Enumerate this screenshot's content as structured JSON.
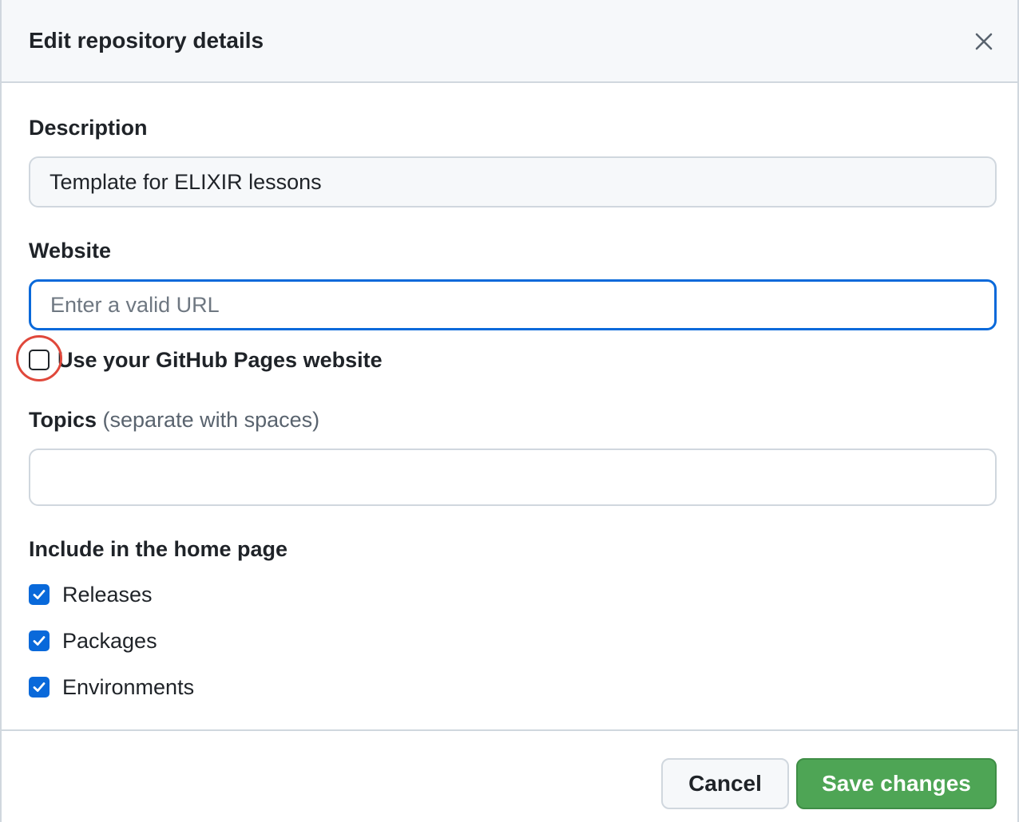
{
  "dialog": {
    "title": "Edit repository details",
    "close_icon": "close-icon"
  },
  "description": {
    "label": "Description",
    "value": "Template for ELIXIR lessons"
  },
  "website": {
    "label": "Website",
    "value": "",
    "placeholder": "Enter a valid URL",
    "pages_checkbox": {
      "label": "Use your GitHub Pages website",
      "checked": false
    }
  },
  "topics": {
    "label": "Topics",
    "hint": "(separate with spaces)",
    "value": ""
  },
  "home_page": {
    "label": "Include in the home page",
    "options": [
      {
        "label": "Releases",
        "checked": true
      },
      {
        "label": "Packages",
        "checked": true
      },
      {
        "label": "Environments",
        "checked": true
      }
    ]
  },
  "footer": {
    "cancel_label": "Cancel",
    "save_label": "Save changes"
  },
  "colors": {
    "accent": "#0969da",
    "save_button": "#4ea555",
    "highlight": "#e0483b"
  }
}
